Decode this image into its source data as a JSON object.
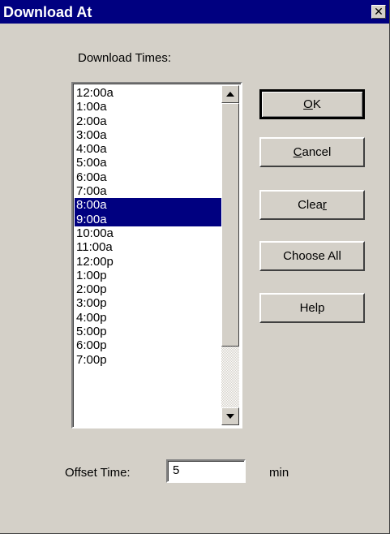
{
  "window": {
    "title": "Download At",
    "close_glyph": "✕"
  },
  "list": {
    "label": "Download Times:",
    "items": [
      {
        "text": "12:00a",
        "selected": false
      },
      {
        "text": "1:00a",
        "selected": false
      },
      {
        "text": "2:00a",
        "selected": false
      },
      {
        "text": "3:00a",
        "selected": false
      },
      {
        "text": "4:00a",
        "selected": false
      },
      {
        "text": "5:00a",
        "selected": false
      },
      {
        "text": "6:00a",
        "selected": false
      },
      {
        "text": "7:00a",
        "selected": false
      },
      {
        "text": "8:00a",
        "selected": true
      },
      {
        "text": "9:00a",
        "selected": true
      },
      {
        "text": "10:00a",
        "selected": false
      },
      {
        "text": "11:00a",
        "selected": false
      },
      {
        "text": "12:00p",
        "selected": false
      },
      {
        "text": "1:00p",
        "selected": false
      },
      {
        "text": "2:00p",
        "selected": false
      },
      {
        "text": "3:00p",
        "selected": false
      },
      {
        "text": "4:00p",
        "selected": false
      },
      {
        "text": "5:00p",
        "selected": false
      },
      {
        "text": "6:00p",
        "selected": false
      },
      {
        "text": "7:00p",
        "selected": false
      }
    ]
  },
  "buttons": {
    "ok": {
      "prefix": "",
      "mnemonic": "O",
      "suffix": "K"
    },
    "cancel": {
      "prefix": "",
      "mnemonic": "C",
      "suffix": "ancel"
    },
    "clear": {
      "prefix": "Clea",
      "mnemonic": "r",
      "suffix": ""
    },
    "choose_all": "Choose All",
    "help": "Help"
  },
  "offset": {
    "label": "Offset Time:",
    "value": "5",
    "unit": "min"
  },
  "colors": {
    "title_bar": "#000080",
    "dialog_bg": "#d4d0c8",
    "selection": "#000080"
  }
}
